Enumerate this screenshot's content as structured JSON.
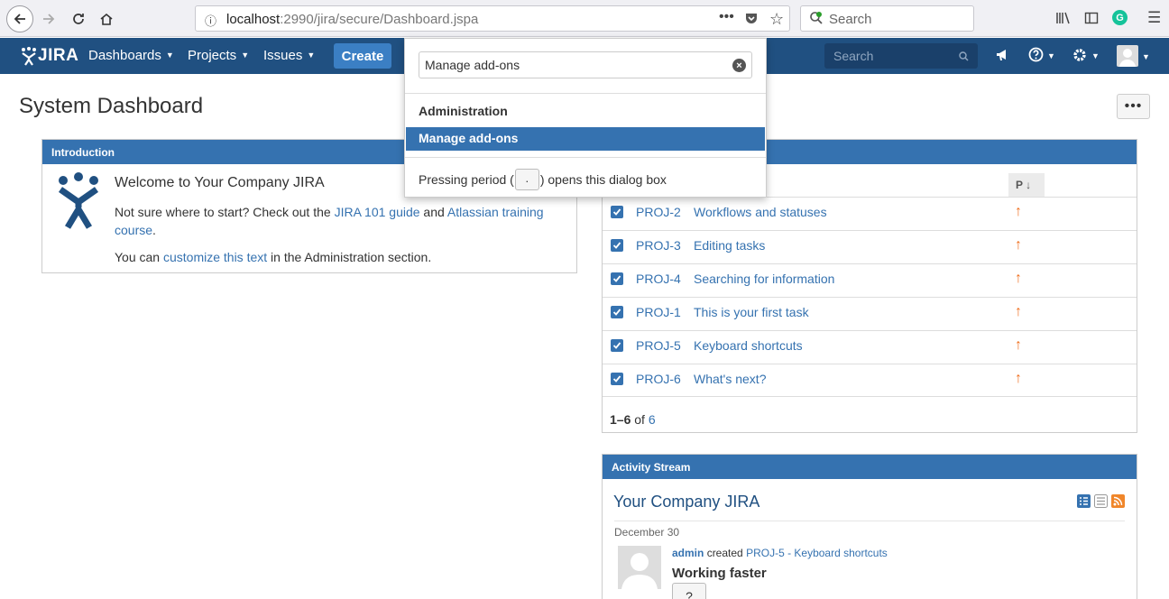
{
  "browser": {
    "url_host": "localhost",
    "url_path": ":2990/jira/secure/Dashboard.jspa",
    "search_placeholder": "Search"
  },
  "header": {
    "logo": "JIRA",
    "nav": [
      "Dashboards",
      "Projects",
      "Issues"
    ],
    "create": "Create",
    "search_placeholder": "Search"
  },
  "page": {
    "title": "System Dashboard",
    "more": "•••"
  },
  "intro": {
    "header": "Introduction",
    "title": "Welcome to Your Company JIRA",
    "p1_a": "Not sure where to start? Check out the ",
    "p1_link1": "JIRA 101 guide",
    "p1_b": " and ",
    "p1_link2": "Atlassian training course",
    "p1_c": ".",
    "p2_a": "You can ",
    "p2_link": "customize this text",
    "p2_b": " in the Administration section."
  },
  "issues": {
    "p_col": "P",
    "rows": [
      {
        "key": "PROJ-2",
        "summary": "Workflows and statuses"
      },
      {
        "key": "PROJ-3",
        "summary": "Editing tasks"
      },
      {
        "key": "PROJ-4",
        "summary": "Searching for information"
      },
      {
        "key": "PROJ-1",
        "summary": "This is your first task"
      },
      {
        "key": "PROJ-5",
        "summary": "Keyboard shortcuts"
      },
      {
        "key": "PROJ-6",
        "summary": "What's next?"
      }
    ],
    "pager_range": "1–6",
    "pager_of": "of",
    "pager_total": "6"
  },
  "activity": {
    "header": "Activity Stream",
    "title": "Your Company JIRA",
    "date": "December 30",
    "user": "admin",
    "verb": "created",
    "item": "PROJ-5 - Keyboard shortcuts",
    "entry_title": "Working faster",
    "key": "?"
  },
  "dialog": {
    "input_value": "Manage add-ons",
    "section": "Administration",
    "item": "Manage add-ons",
    "hint_a": "Pressing period (",
    "hint_key": ".",
    "hint_b": ") opens this dialog box"
  },
  "colors": {
    "header": "#205081",
    "accent": "#3572b0",
    "priority": "#f07020"
  }
}
